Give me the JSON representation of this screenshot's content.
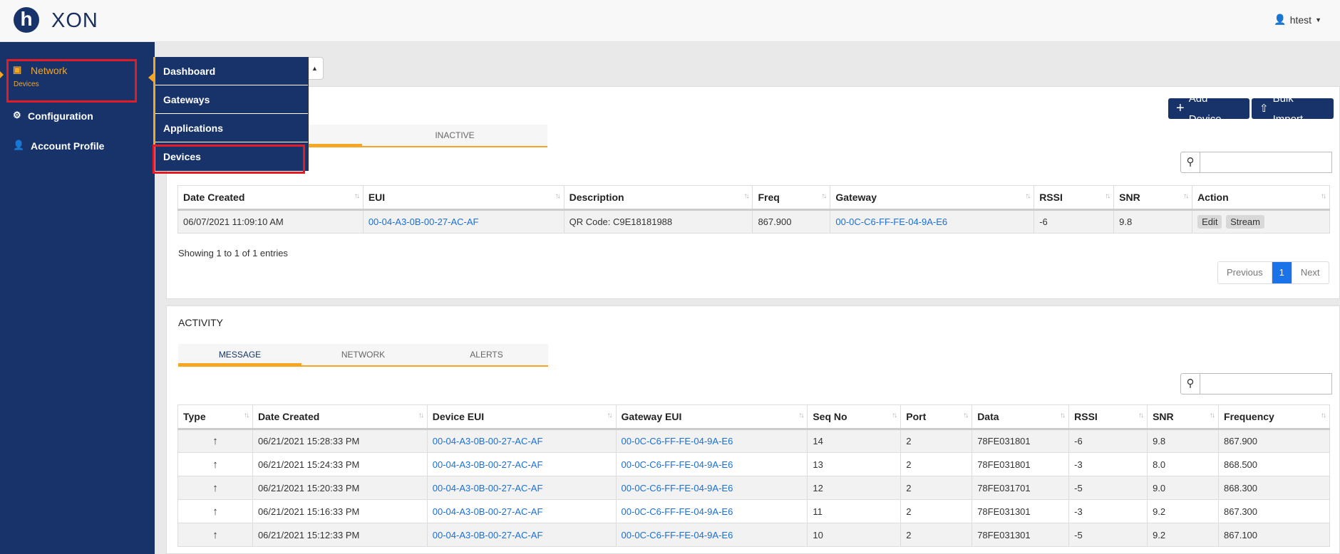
{
  "brand": {
    "logo_letter": "h",
    "name": "XON"
  },
  "user": {
    "name": "htest"
  },
  "sidebar": {
    "items": [
      {
        "label": "Network",
        "sub": "Devices"
      },
      {
        "label": "Configuration"
      },
      {
        "label": "Account Profile"
      }
    ]
  },
  "flyout": {
    "items": [
      "Dashboard",
      "Gateways",
      "Applications",
      "Devices"
    ]
  },
  "devices": {
    "add_label": "Add Device",
    "bulk_label": "Bulk Import",
    "tab_inactive": "INACTIVE",
    "columns": [
      "Date Created",
      "EUI",
      "Description",
      "Freq",
      "Gateway",
      "RSSI",
      "SNR",
      "Action"
    ],
    "row": {
      "date": "06/07/2021 11:09:10 AM",
      "eui": "00-04-A3-0B-00-27-AC-AF",
      "description": "QR Code: C9E18181988",
      "freq": "867.900",
      "gateway": "00-0C-C6-FF-FE-04-9A-E6",
      "rssi": "-6",
      "snr": "9.8",
      "edit": "Edit",
      "stream": "Stream"
    },
    "info": "Showing 1 to 1 of 1 entries",
    "pager": {
      "prev": "Previous",
      "current": "1",
      "next": "Next"
    }
  },
  "activity": {
    "title": "ACTIVITY",
    "tabs": [
      "MESSAGE",
      "NETWORK",
      "ALERTS"
    ],
    "columns": [
      "Type",
      "Date Created",
      "Device EUI",
      "Gateway EUI",
      "Seq No",
      "Port",
      "Data",
      "RSSI",
      "SNR",
      "Frequency"
    ],
    "rows": [
      {
        "date": "06/21/2021 15:28:33 PM",
        "device": "00-04-A3-0B-00-27-AC-AF",
        "gateway": "00-0C-C6-FF-FE-04-9A-E6",
        "seq": "14",
        "port": "2",
        "data": "78FE031801",
        "rssi": "-6",
        "snr": "9.8",
        "freq": "867.900"
      },
      {
        "date": "06/21/2021 15:24:33 PM",
        "device": "00-04-A3-0B-00-27-AC-AF",
        "gateway": "00-0C-C6-FF-FE-04-9A-E6",
        "seq": "13",
        "port": "2",
        "data": "78FE031801",
        "rssi": "-3",
        "snr": "8.0",
        "freq": "868.500"
      },
      {
        "date": "06/21/2021 15:20:33 PM",
        "device": "00-04-A3-0B-00-27-AC-AF",
        "gateway": "00-0C-C6-FF-FE-04-9A-E6",
        "seq": "12",
        "port": "2",
        "data": "78FE031701",
        "rssi": "-5",
        "snr": "9.0",
        "freq": "868.300"
      },
      {
        "date": "06/21/2021 15:16:33 PM",
        "device": "00-04-A3-0B-00-27-AC-AF",
        "gateway": "00-0C-C6-FF-FE-04-9A-E6",
        "seq": "11",
        "port": "2",
        "data": "78FE031301",
        "rssi": "-3",
        "snr": "9.2",
        "freq": "867.300"
      },
      {
        "date": "06/21/2021 15:12:33 PM",
        "device": "00-04-A3-0B-00-27-AC-AF",
        "gateway": "00-0C-C6-FF-FE-04-9A-E6",
        "seq": "10",
        "port": "2",
        "data": "78FE031301",
        "rssi": "-5",
        "snr": "9.2",
        "freq": "867.100"
      }
    ]
  }
}
